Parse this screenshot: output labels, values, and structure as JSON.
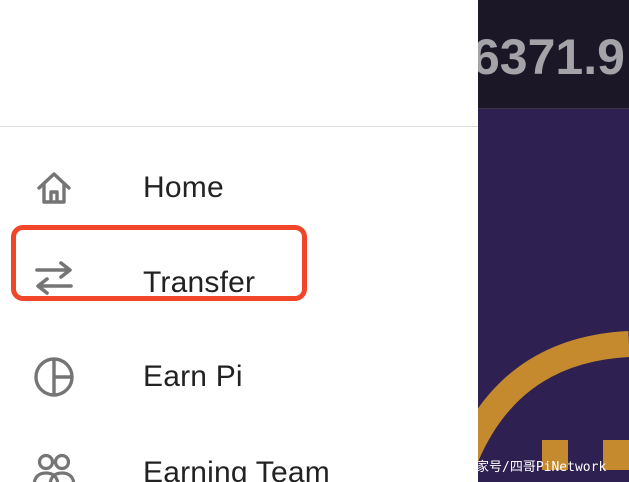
{
  "menu": {
    "items": [
      {
        "icon": "home-icon",
        "label": "Home"
      },
      {
        "icon": "transfer-icon",
        "label": "Transfer"
      },
      {
        "icon": "pie-chart-icon",
        "label": "Earn Pi"
      },
      {
        "icon": "team-icon",
        "label": "Earning Team"
      }
    ]
  },
  "background": {
    "balance": "6371.9"
  },
  "watermark": "家号/四哥PiNetwork",
  "colors": {
    "highlight": "#f2462a",
    "icon": "#757575",
    "app_bg": "#2e2050",
    "topbar_bg": "#1c1726",
    "arc": "#c68a2e"
  }
}
